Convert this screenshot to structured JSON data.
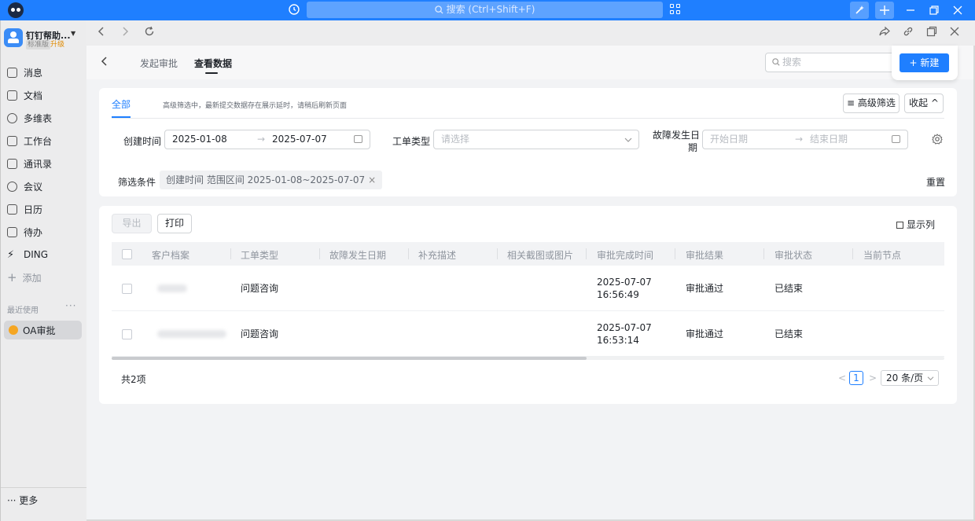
{
  "titlebar": {
    "search_placeholder": "搜索 (Ctrl+Shift+F)"
  },
  "sidebar": {
    "org_name": "钉钉帮助...",
    "org_plan": "标准版",
    "org_upgrade": "升级",
    "items": [
      {
        "label": "消息",
        "icon": "message-icon"
      },
      {
        "label": "文档",
        "icon": "document-icon"
      },
      {
        "label": "多维表",
        "icon": "table-icon"
      },
      {
        "label": "工作台",
        "icon": "workbench-icon"
      },
      {
        "label": "通讯录",
        "icon": "contacts-icon"
      },
      {
        "label": "会议",
        "icon": "meeting-icon"
      },
      {
        "label": "日历",
        "icon": "calendar-icon"
      },
      {
        "label": "待办",
        "icon": "todo-icon"
      },
      {
        "label": "DING",
        "icon": "ding-icon"
      },
      {
        "label": "添加",
        "icon": "plus-icon"
      }
    ],
    "recent_label": "最近使用",
    "recent_more": "···",
    "recent_item": "OA审批",
    "more_label": "更多",
    "more_prefix": "···"
  },
  "header": {
    "tabs": [
      "发起审批",
      "查看数据"
    ],
    "search_placeholder": "搜索",
    "new_button": "新建"
  },
  "filter": {
    "tab_all": "全部",
    "hint": "高级筛选中，最新提交数据存在展示延时，请稍后刷新页面",
    "advanced_button": "高级筛选",
    "collapse_button": "收起",
    "created_label": "创建时间",
    "created_start": "2025-01-08",
    "created_end": "2025-07-07",
    "range_arrow": "→",
    "type_label": "工单类型",
    "type_placeholder": "请选择",
    "fault_label_1": "故障发生日",
    "fault_label_2": "期",
    "fault_start_placeholder": "开始日期",
    "fault_end_placeholder": "结束日期",
    "conditions_label": "筛选条件",
    "condition_chip": "创建时间 范围区间 2025-01-08~2025-07-07",
    "chip_close": "×",
    "reset_button": "重置"
  },
  "table": {
    "export_button": "导出",
    "print_button": "打印",
    "columns_button": "显示列",
    "columns": [
      "客户档案",
      "工单类型",
      "故障发生日期",
      "补充描述",
      "相关截图或图片",
      "审批完成时间",
      "审批结果",
      "审批状态",
      "当前节点"
    ],
    "rows": [
      {
        "type": "问题咨询",
        "completed_date": "2025-07-07",
        "completed_time": "16:56:49",
        "result": "审批通过",
        "status": "已结束"
      },
      {
        "type": "问题咨询",
        "completed_date": "2025-07-07",
        "completed_time": "16:53:14",
        "result": "审批通过",
        "status": "已结束"
      }
    ],
    "total": "共2项",
    "page": "1",
    "page_size": "20 条/页",
    "prev": "<",
    "next": ">",
    "scroll_fraction": 0.57
  },
  "colors": {
    "accent": "#1f7fff",
    "titlebar": "#1f7fff"
  }
}
